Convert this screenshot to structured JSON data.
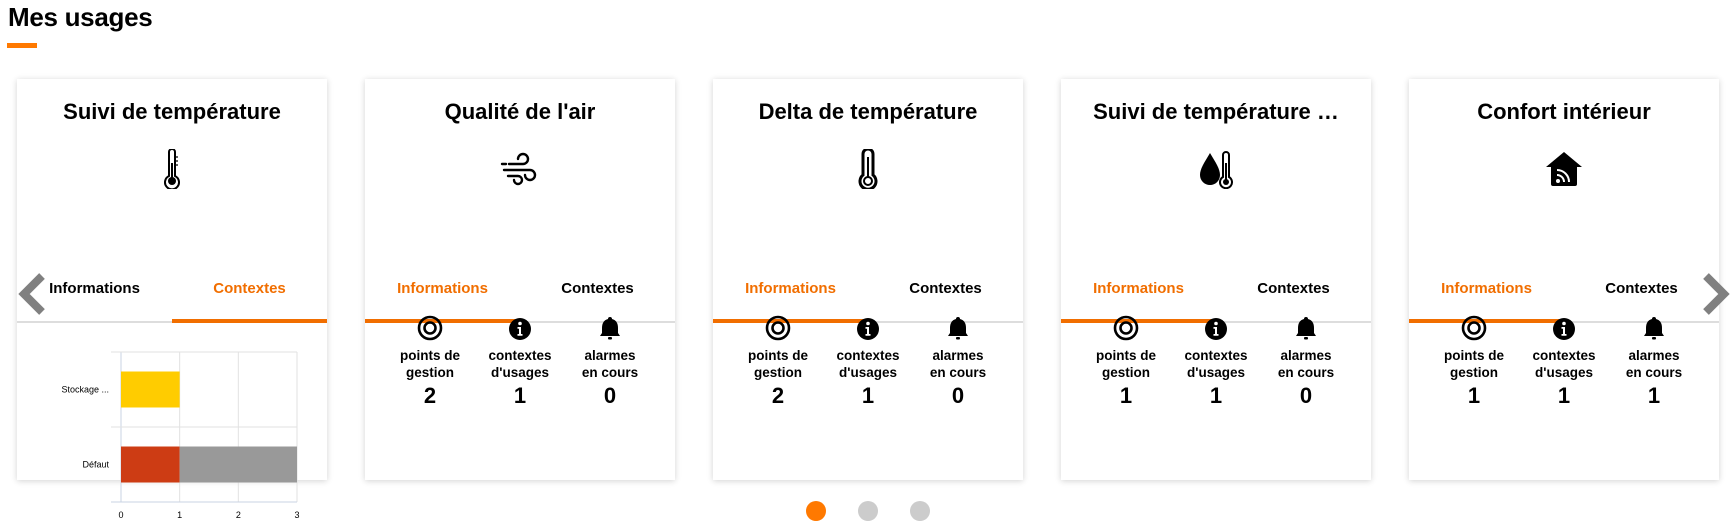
{
  "page": {
    "title": "Mes usages",
    "accent_color": "#ff7900"
  },
  "cards": [
    {
      "title": "Suivi de température",
      "icon": "thermometer-icon",
      "tabs": [
        {
          "label": "Informations",
          "active": false
        },
        {
          "label": "Contextes",
          "active": true
        }
      ]
    },
    {
      "title": "Qualité de l'air",
      "icon": "wind-icon",
      "tabs": [
        {
          "label": "Informations",
          "active": true
        },
        {
          "label": "Contextes",
          "active": false
        }
      ],
      "stats": [
        {
          "icon": "target-icon",
          "label_line1": "points de",
          "label_line2": "gestion",
          "value": "2"
        },
        {
          "icon": "info-icon",
          "label_line1": "contextes",
          "label_line2": "d'usages",
          "value": "1"
        },
        {
          "icon": "bell-icon",
          "label_line1": "alarmes",
          "label_line2": "en cours",
          "value": "0"
        }
      ]
    },
    {
      "title": "Delta de température",
      "icon": "thermometer-outline-icon",
      "tabs": [
        {
          "label": "Informations",
          "active": true
        },
        {
          "label": "Contextes",
          "active": false
        }
      ],
      "stats": [
        {
          "icon": "target-icon",
          "label_line1": "points de",
          "label_line2": "gestion",
          "value": "2"
        },
        {
          "icon": "info-icon",
          "label_line1": "contextes",
          "label_line2": "d'usages",
          "value": "1"
        },
        {
          "icon": "bell-icon",
          "label_line1": "alarmes",
          "label_line2": "en cours",
          "value": "0"
        }
      ]
    },
    {
      "title": "Suivi de température …",
      "icon": "humidity-thermometer-icon",
      "tabs": [
        {
          "label": "Informations",
          "active": true
        },
        {
          "label": "Contextes",
          "active": false
        }
      ],
      "stats": [
        {
          "icon": "target-icon",
          "label_line1": "points de",
          "label_line2": "gestion",
          "value": "1"
        },
        {
          "icon": "info-icon",
          "label_line1": "contextes",
          "label_line2": "d'usages",
          "value": "1"
        },
        {
          "icon": "bell-icon",
          "label_line1": "alarmes",
          "label_line2": "en cours",
          "value": "0"
        }
      ]
    },
    {
      "title": "Confort intérieur",
      "icon": "smart-home-icon",
      "tabs": [
        {
          "label": "Informations",
          "active": true
        },
        {
          "label": "Contextes",
          "active": false
        }
      ],
      "stats": [
        {
          "icon": "target-icon",
          "label_line1": "points de",
          "label_line2": "gestion",
          "value": "1"
        },
        {
          "icon": "info-icon",
          "label_line1": "contextes",
          "label_line2": "d'usages",
          "value": "1"
        },
        {
          "icon": "bell-icon",
          "label_line1": "alarmes",
          "label_line2": "en cours",
          "value": "1"
        }
      ]
    }
  ],
  "chart_data": {
    "type": "bar",
    "orientation": "horizontal",
    "stacked": true,
    "title": "",
    "xlabel": "",
    "ylabel": "",
    "categories": [
      "Stockage ...",
      "Défaut"
    ],
    "series": [
      {
        "name": "series-1",
        "color": "#ffcc00",
        "values": [
          1,
          0
        ]
      },
      {
        "name": "series-2",
        "color": "#cd3c14",
        "values": [
          0,
          1
        ]
      },
      {
        "name": "series-3",
        "color": "#999999",
        "values": [
          0,
          2
        ]
      }
    ],
    "xlim": [
      0,
      3
    ],
    "xticks": [
      "0",
      "1",
      "2",
      "3"
    ],
    "grid": true,
    "legend": "none"
  },
  "carousel": {
    "pages": 3,
    "active_page": 1,
    "prev_label": "previous",
    "next_label": "next"
  }
}
